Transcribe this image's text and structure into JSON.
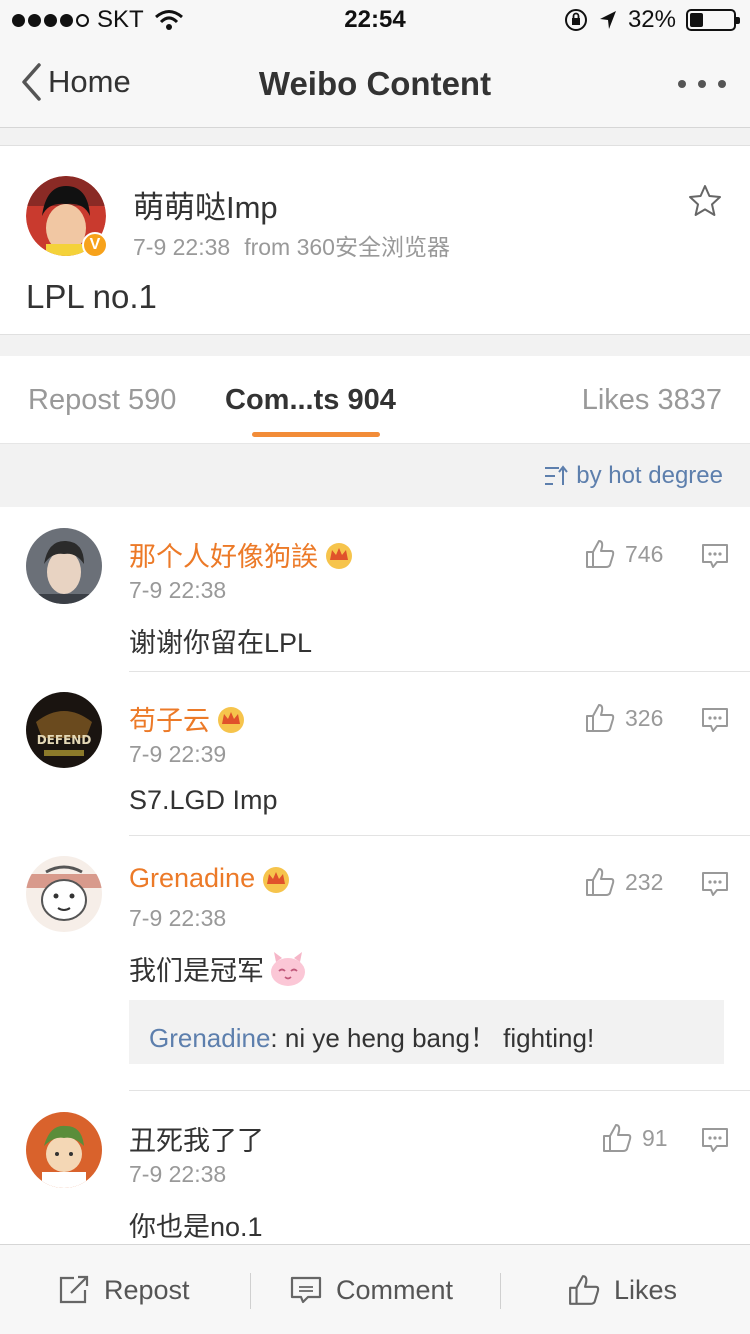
{
  "status_bar": {
    "carrier": "SKT",
    "time": "22:54",
    "battery_percent": "32%",
    "battery_level": 0.32
  },
  "nav": {
    "back_label": "Home",
    "title": "Weibo Content"
  },
  "post": {
    "author": "萌萌哒Imp",
    "verified_badge": "V",
    "time": "7-9 22:38",
    "source": "from 360安全浏览器",
    "text": "LPL no.1"
  },
  "tabs": {
    "repost": "Repost 590",
    "comments": "Com...ts 904",
    "likes": "Likes 3837"
  },
  "sort": {
    "label": "by hot degree"
  },
  "comments": [
    {
      "name": "那个人好像狗誒",
      "time": "7-9 22:38",
      "text": "谢谢你留在LPL",
      "likes": "746"
    },
    {
      "name": "苟子云",
      "time": "7-9 22:39",
      "text": "S7.LGD Imp",
      "likes": "326",
      "avatar_text": "DEFEND"
    },
    {
      "name": "Grenadine",
      "time": "7-9 22:38",
      "text": "我们是冠军",
      "likes": "232",
      "reply": {
        "name": "Grenadine",
        "text": ": ni ye heng bang！ fighting!"
      }
    },
    {
      "name": "丑死我了了",
      "time": "7-9 22:38",
      "text": "你也是no.1",
      "likes": "91"
    }
  ],
  "bottom_bar": {
    "repost": "Repost",
    "comment": "Comment",
    "likes": "Likes"
  },
  "colors": {
    "accent": "#f28c38",
    "name_orange": "#ec7a28",
    "link_blue": "#5d7fad",
    "muted": "#999999"
  }
}
